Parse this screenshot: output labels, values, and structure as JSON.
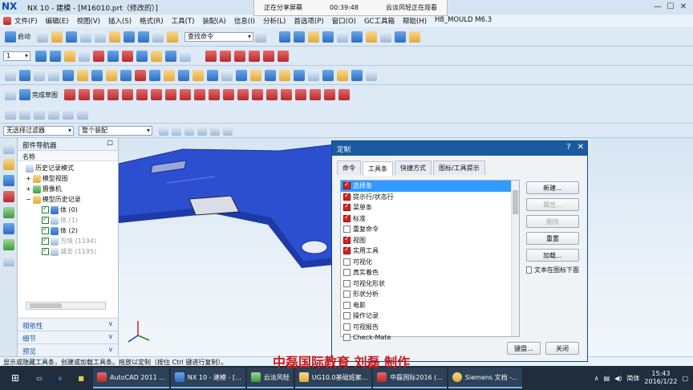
{
  "window": {
    "title": "NX 10 - 建模 - [M16010.prt（修改的）]",
    "logo": "NX"
  },
  "share_banner": {
    "status": "正在分享屏幕",
    "time": "00:39:48",
    "viewer": "云淡风轻正在观看"
  },
  "menu": [
    "文件(F)",
    "编辑(E)",
    "视图(V)",
    "插入(S)",
    "格式(R)",
    "工具(T)",
    "装配(A)",
    "信息(I)",
    "分析(L)",
    "首选项(P)",
    "窗口(O)",
    "GC工具箱",
    "帮助(H)",
    "H8_MOULD M6.3"
  ],
  "toolbar": {
    "start_label": "启动",
    "command_search": "查找命令",
    "layer": "1",
    "finish_sketch": "完成草图",
    "filter": "无选择过滤器",
    "scope": "整个装配"
  },
  "navigator": {
    "title": "部件导航器",
    "column": "名称",
    "tree": [
      {
        "label": "历史记录模式",
        "kind": "mode"
      },
      {
        "label": "模型视图",
        "kind": "folder"
      },
      {
        "label": "摄像机",
        "kind": "folder"
      },
      {
        "label": "模型历史记录",
        "kind": "folder"
      },
      {
        "label": "体 (0)",
        "kind": "item"
      },
      {
        "label": "体 (1)",
        "kind": "item-gray"
      },
      {
        "label": "体 (2)",
        "kind": "item"
      },
      {
        "label": "方块 (1194)",
        "kind": "item-gray"
      },
      {
        "label": "减去 (1195)",
        "kind": "item-gray"
      }
    ],
    "sections": [
      "相依性",
      "细节",
      "预览"
    ]
  },
  "dialog": {
    "title": "定制",
    "tabs": [
      "命令",
      "工具条",
      "快捷方式",
      "图标/工具提示"
    ],
    "active_tab": 1,
    "items": [
      {
        "label": "选择条",
        "checked": true,
        "selected": true
      },
      {
        "label": "提示行/状态行",
        "checked": true
      },
      {
        "label": "菜单条",
        "checked": true
      },
      {
        "label": "标准",
        "checked": true
      },
      {
        "label": "重复命令",
        "checked": false
      },
      {
        "label": "视图",
        "checked": true
      },
      {
        "label": "实用工具",
        "checked": true
      },
      {
        "label": "可视化",
        "checked": false
      },
      {
        "label": "真实着色",
        "checked": false
      },
      {
        "label": "可视化形状",
        "checked": false
      },
      {
        "label": "形状分析",
        "checked": false
      },
      {
        "label": "电影",
        "checked": false
      },
      {
        "label": "操作记录",
        "checked": false
      },
      {
        "label": "可视报告",
        "checked": false
      },
      {
        "label": "Check-Mate",
        "checked": false
      }
    ],
    "buttons": {
      "new": "新建...",
      "properties": "属性...",
      "delete": "删除",
      "reset": "重置",
      "load": "加载...",
      "keyboard": "键盘...",
      "close": "关闭"
    },
    "text_below_icon": "文本在图标下面"
  },
  "status_bar": "显示或隐藏工具条，创建或加载工具条。拖放以定制（按住 Ctrl 键进行复制）。",
  "watermark": "中磊国际教育 刘磊 制作",
  "taskbar": {
    "tasks": [
      "AutoCAD 2011 ...",
      "NX 10 - 建模 - [...",
      "云淡风轻",
      "UG10.0基础班案...",
      "中磊国际2016 (...",
      "Siemens 文档 -..."
    ],
    "ime": "简体",
    "time": "15:43",
    "date": "2016/1/22"
  },
  "colors": {
    "accent": "#1a5aa0",
    "model": "#2c4fd0",
    "selection": "#3399ff"
  }
}
